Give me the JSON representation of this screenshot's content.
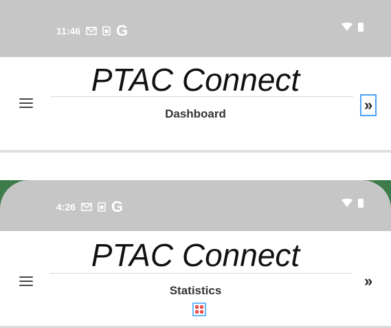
{
  "panels": [
    {
      "status_time": "11:46",
      "status_icons": [
        "gmail-icon",
        "sim-icon",
        "google-icon"
      ],
      "app_title": "PTAC Connect",
      "subtitle": "Dashboard",
      "left_button_icon": "hamburger-menu-icon",
      "right_button_icon": "double-chevron-right-icon",
      "right_button_highlighted": true
    },
    {
      "status_time": "4:26",
      "status_icons": [
        "gmail-icon",
        "sim-icon",
        "google-icon"
      ],
      "app_title": "PTAC Connect",
      "subtitle": "Statistics",
      "left_button_icon": "hamburger-menu-icon",
      "right_button_icon": "double-chevron-right-icon",
      "right_button_highlighted": false,
      "subtitle_icon": "dashboard-grid-icon"
    }
  ],
  "colors": {
    "status_bar": "#c6c6c6",
    "green_wallpaper": "#3e7b4a",
    "focus_outline": "#4da3ff",
    "grid_icon": "#e53935"
  }
}
